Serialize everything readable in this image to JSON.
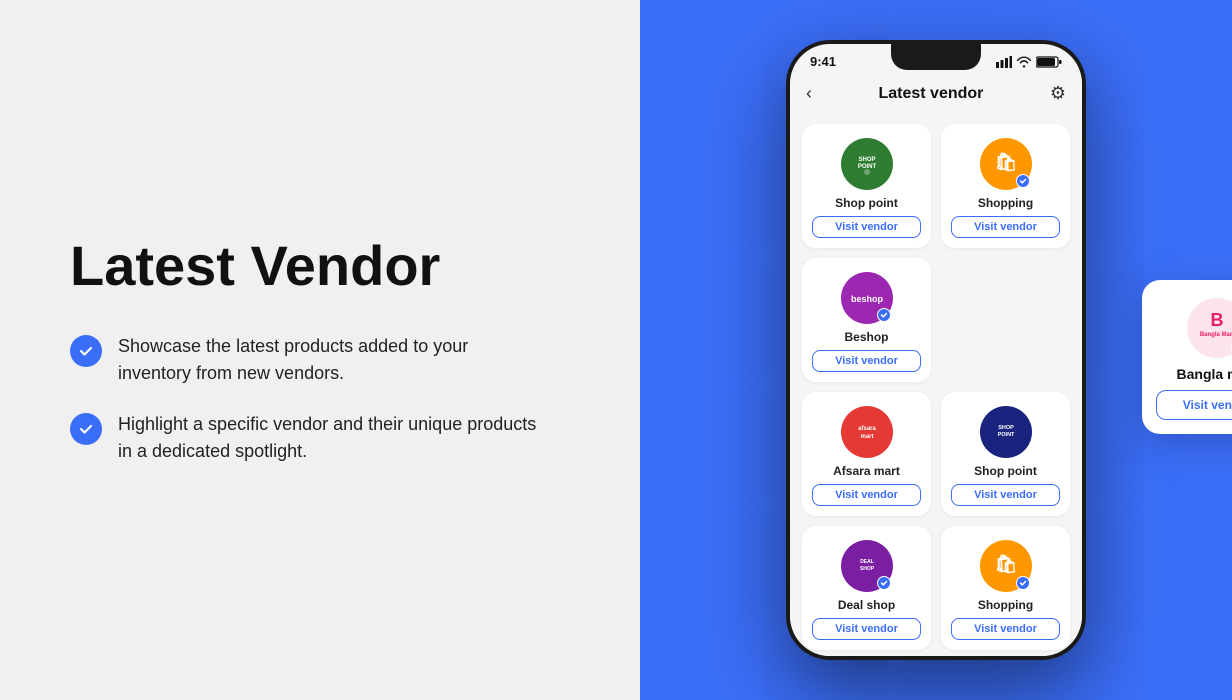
{
  "left": {
    "title": "Latest Vendor",
    "features": [
      {
        "id": "feature-1",
        "text": "Showcase the latest products added to your inventory from new vendors."
      },
      {
        "id": "feature-2",
        "text": "Highlight a specific vendor and their unique products in a dedicated spotlight."
      }
    ]
  },
  "phone": {
    "status": {
      "time": "9:41",
      "signal": "▲▲▲",
      "wifi": "WiFi",
      "battery": "Battery"
    },
    "nav": {
      "back": "‹",
      "title": "Latest vendor",
      "filter": "⚙"
    },
    "vendors": [
      {
        "id": "shop-point-1",
        "name": "Shop point",
        "logoColor": "logo-green",
        "logoText": "SHOP\nPOINT",
        "verified": false
      },
      {
        "id": "shopping-1",
        "name": "Shopping",
        "logoColor": "logo-orange",
        "logoText": "🛍",
        "verified": true
      },
      {
        "id": "beshop",
        "name": "Beshop",
        "logoColor": "logo-purple",
        "logoText": "beshop",
        "verified": true
      },
      {
        "id": "placeholder",
        "name": "",
        "logoColor": "",
        "logoText": "",
        "verified": false,
        "hidden": true
      },
      {
        "id": "afsara-mart",
        "name": "Afsara mart",
        "logoColor": "logo-red",
        "logoText": "afsara\nmart",
        "verified": false
      },
      {
        "id": "shop-point-2",
        "name": "Shop point",
        "logoColor": "logo-darkblue",
        "logoText": "SHOP\nPOINT",
        "verified": false
      },
      {
        "id": "deal-shop",
        "name": "Deal shop",
        "logoColor": "logo-dealshop",
        "logoText": "DEAL\nSHOP",
        "verified": true
      },
      {
        "id": "shopping-2",
        "name": "Shopping",
        "logoColor": "logo-orange",
        "logoText": "🛍",
        "verified": true
      }
    ],
    "visitButtonLabel": "Visit vendor",
    "popup": {
      "name": "Bangla mart",
      "logoText": "B\nBangla Mart",
      "visitLabel": "Visit vendor"
    }
  },
  "colors": {
    "accent": "#3b6ef8",
    "background": "#3b6ef8"
  }
}
